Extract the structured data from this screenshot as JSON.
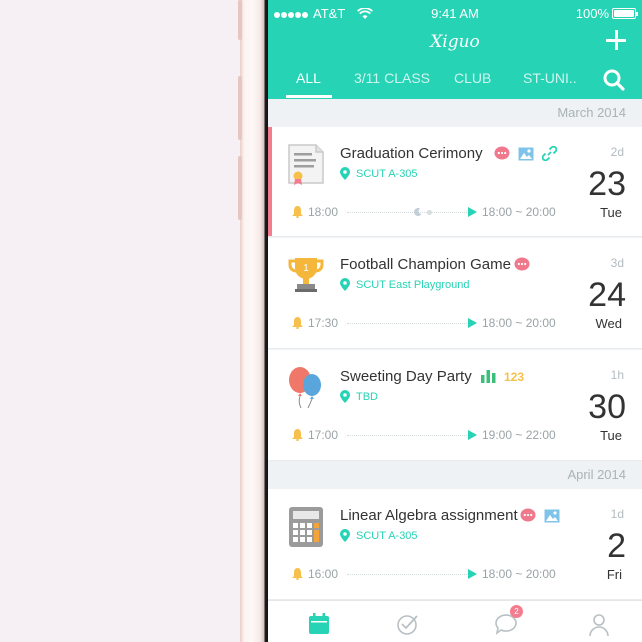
{
  "status_bar": {
    "carrier": "AT&T",
    "time": "9:41 AM",
    "battery": "100%"
  },
  "header": {
    "app_title": "Xiguo",
    "add_icon": "plus-icon",
    "search_icon": "search-icon"
  },
  "tabs": [
    {
      "label": "ALL",
      "active": true
    },
    {
      "label": "3/11 CLASS",
      "active": false
    },
    {
      "label": "CLUB",
      "active": false
    },
    {
      "label": "ST-UNI..",
      "active": false
    }
  ],
  "sections": [
    {
      "label": "March 2014"
    },
    {
      "label": "April 2014"
    }
  ],
  "events": [
    {
      "title": "Graduation Cerimony",
      "location": "SCUT A-305",
      "ago": "2d",
      "day": "23",
      "weekday": "Tue",
      "reminder": "18:00",
      "time_range": "18:00 ~ 20:00",
      "icon": "certificate-icon",
      "badges": [
        "chat-icon",
        "image-icon",
        "link-icon"
      ],
      "highlight": true
    },
    {
      "title": "Football Champion Game",
      "location": "SCUT East Playground",
      "ago": "3d",
      "day": "24",
      "weekday": "Wed",
      "reminder": "17:30",
      "time_range": "18:00 ~ 20:00",
      "icon": "trophy-icon",
      "badges": [
        "chat-icon"
      ],
      "highlight": false
    },
    {
      "title": "Sweeting Day Party",
      "location": "TBD",
      "ago": "1h",
      "day": "30",
      "weekday": "Tue",
      "reminder": "17:00",
      "time_range": "19:00 ~ 22:00",
      "icon": "balloons-icon",
      "badges": [
        "bar-chart-icon",
        "numbers-icon"
      ],
      "highlight": false
    },
    {
      "title": "Linear Algebra assignment",
      "location": "SCUT A-305",
      "ago": "1d",
      "day": "2",
      "weekday": "Fri",
      "reminder": "16:00",
      "time_range": "18:00 ~ 20:00",
      "icon": "calculator-icon",
      "badges": [
        "chat-icon",
        "image-icon"
      ],
      "highlight": false
    }
  ],
  "tabbar": {
    "items": [
      "calendar-icon",
      "check-icon",
      "message-icon",
      "profile-icon"
    ],
    "message_badge": "2"
  },
  "colors": {
    "accent": "#27d3b5",
    "highlight": "#f47c8f",
    "reminder": "#f7c04a"
  }
}
